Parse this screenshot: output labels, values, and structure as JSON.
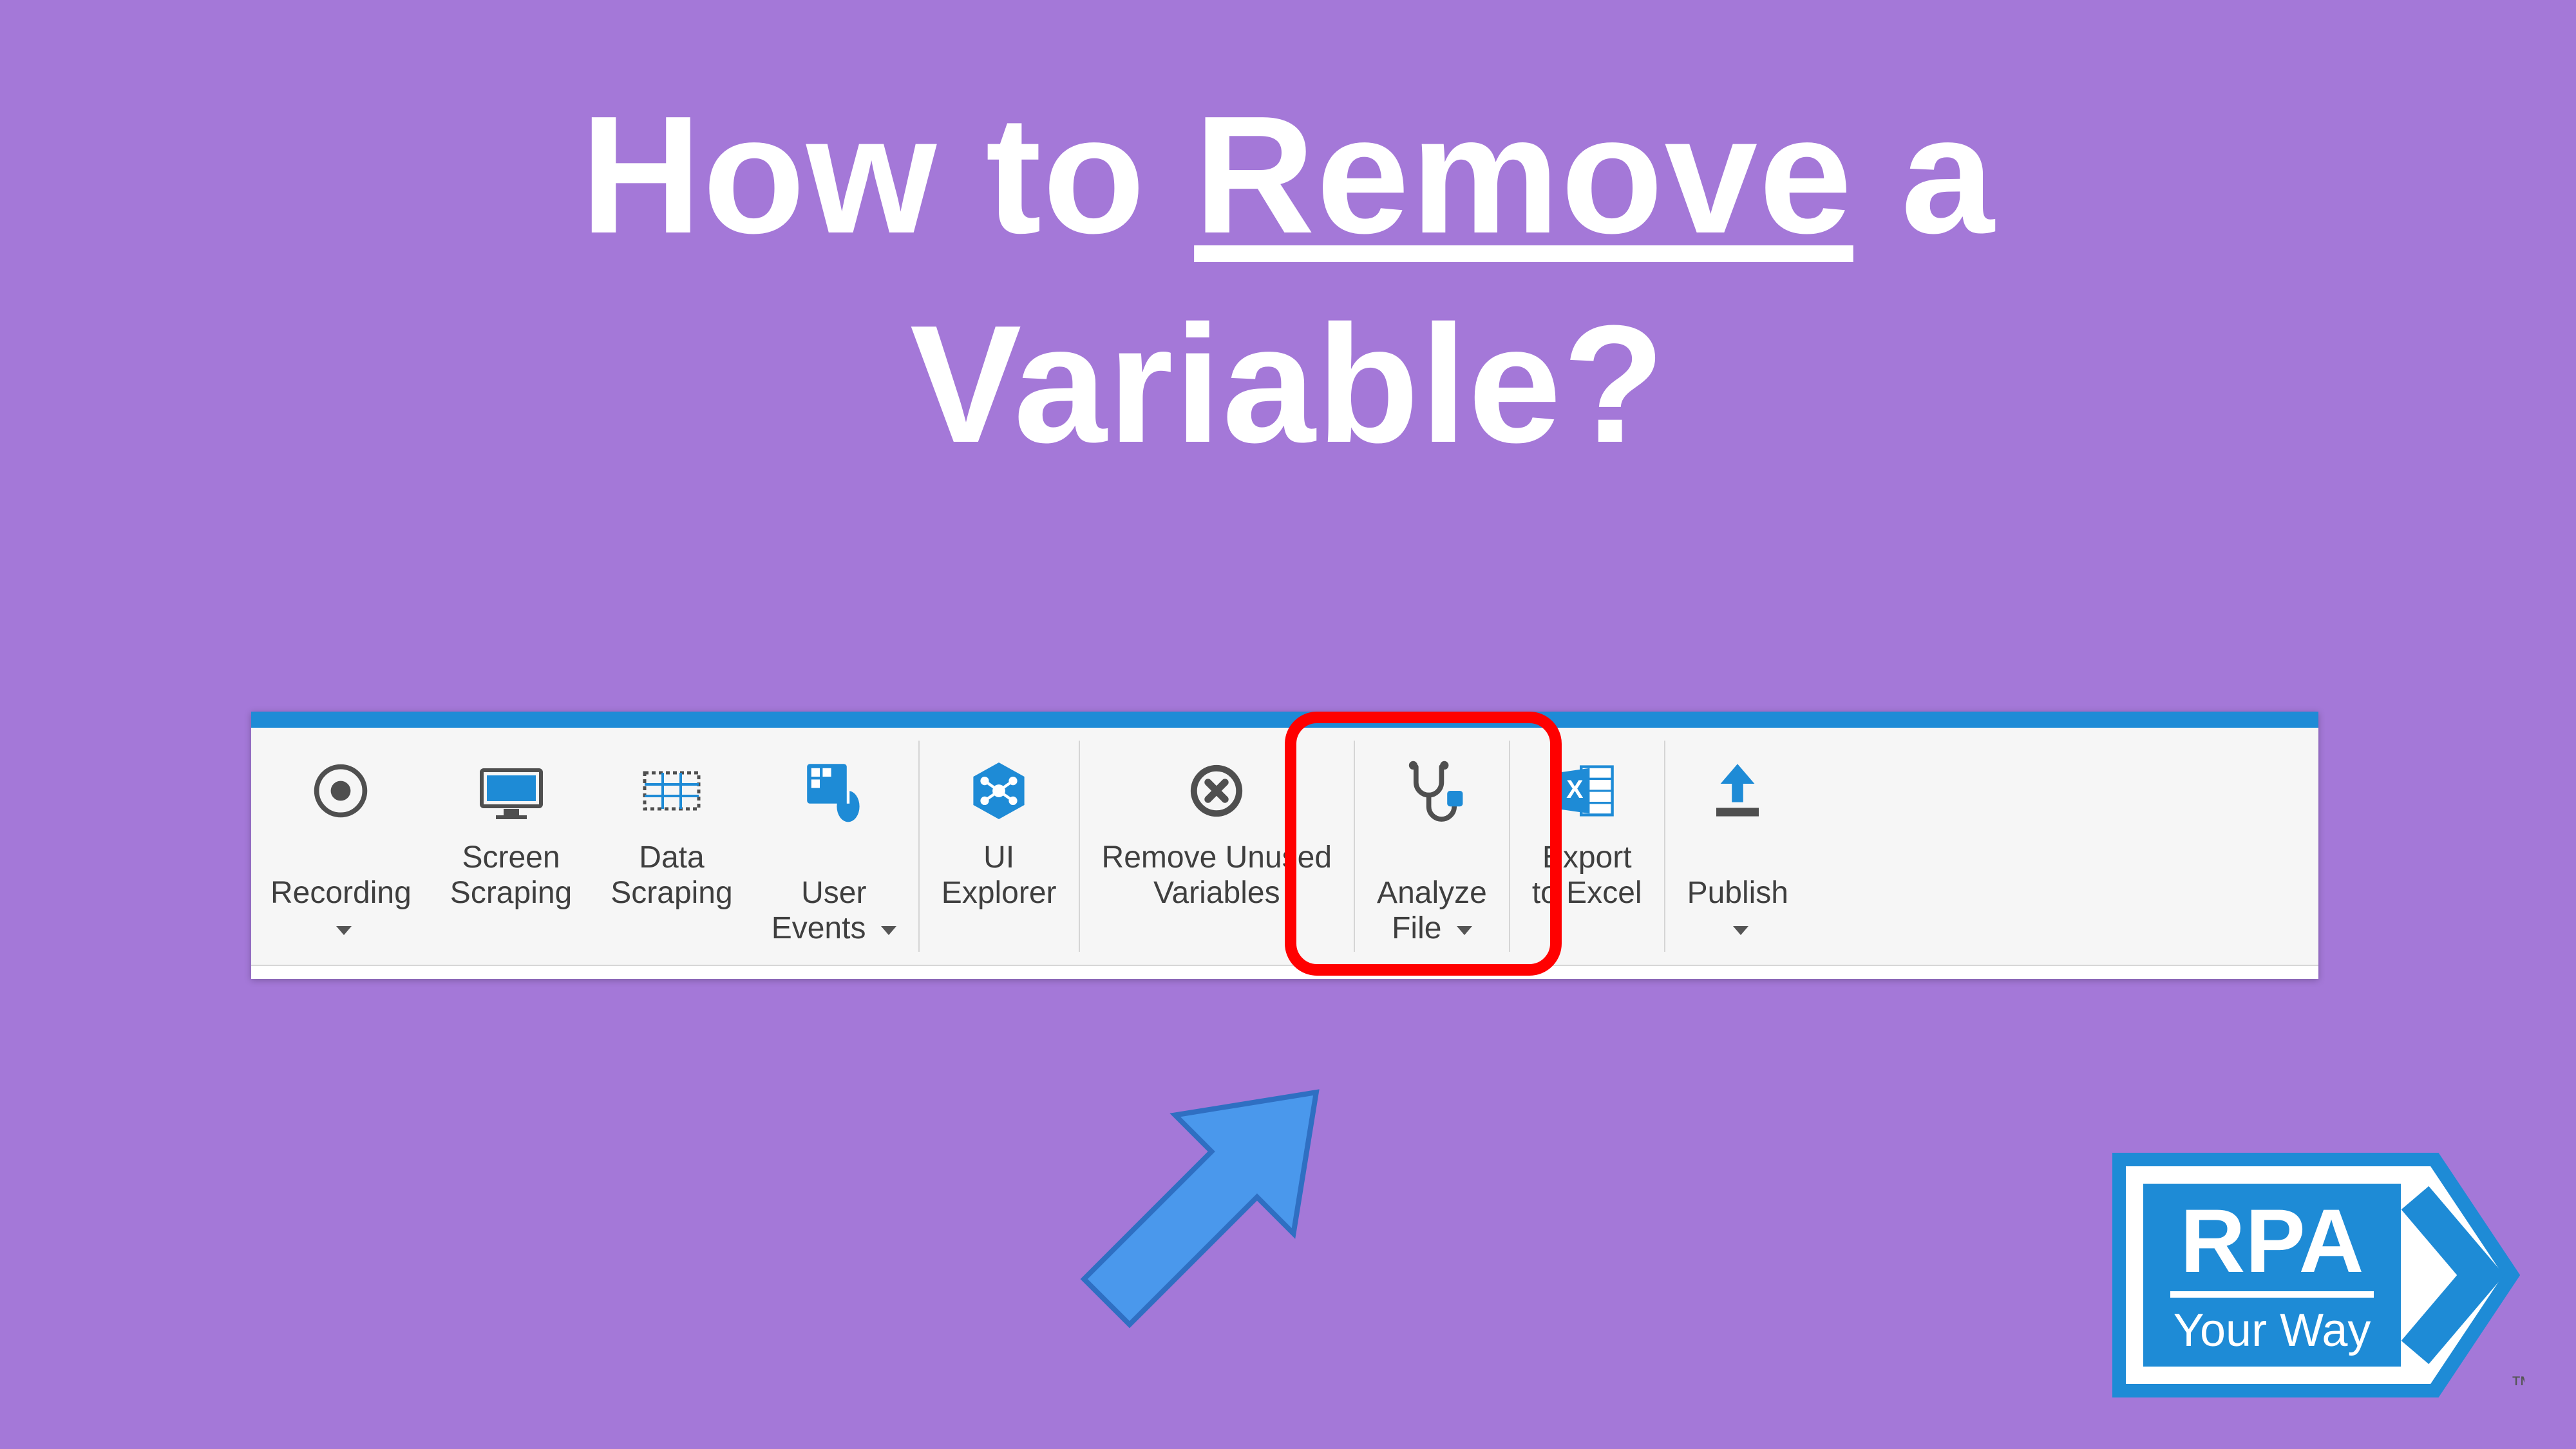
{
  "title": {
    "prefix": "How to ",
    "underlined": "Remove",
    "suffix": " a\nVariable?"
  },
  "ribbon": {
    "items": [
      {
        "label": "Recording",
        "dropdown": true
      },
      {
        "label": "Screen\nScraping",
        "dropdown": false
      },
      {
        "label": "Data\nScraping",
        "dropdown": false
      },
      {
        "label": "User\nEvents",
        "dropdown": true
      },
      {
        "sep": true
      },
      {
        "label": "UI\nExplorer",
        "dropdown": false
      },
      {
        "sep": true
      },
      {
        "label": "Remove Unused\nVariables",
        "dropdown": false,
        "highlight": true
      },
      {
        "sep": true
      },
      {
        "label": "Analyze\nFile",
        "dropdown": true
      },
      {
        "sep": true
      },
      {
        "label": "Export\nto Excel",
        "dropdown": false
      },
      {
        "sep": true
      },
      {
        "label": "Publish",
        "dropdown": true
      }
    ]
  },
  "logo": {
    "line1": "RPA",
    "line2": "Your Way",
    "tm": "™"
  }
}
